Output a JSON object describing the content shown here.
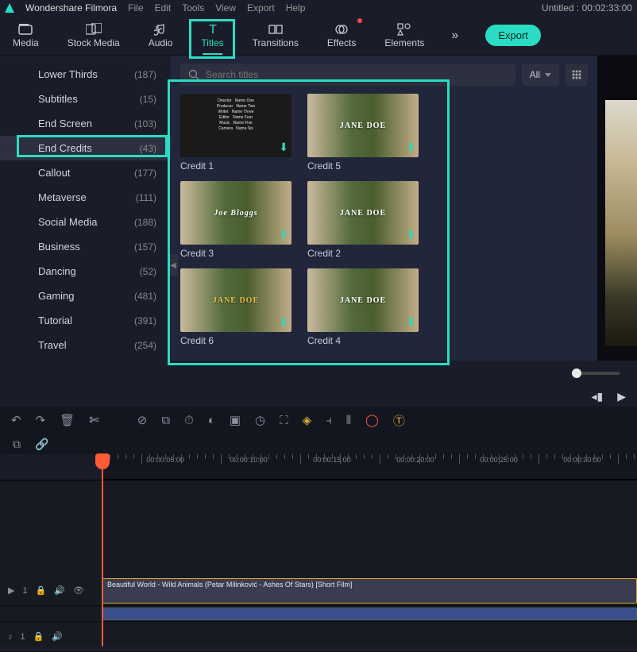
{
  "app": {
    "brand": "Wondershare Filmora",
    "project_title": "Untitled : 00:02:33:00"
  },
  "menu": {
    "file": "File",
    "edit": "Edit",
    "tools": "Tools",
    "view": "View",
    "export": "Export",
    "help": "Help"
  },
  "tabs": {
    "media": "Media",
    "stock": "Stock Media",
    "audio": "Audio",
    "titles": "Titles",
    "transitions": "Transitions",
    "effects": "Effects",
    "elements": "Elements"
  },
  "export_button": "Export",
  "sidebar": {
    "items": [
      {
        "label": "Lower Thirds",
        "count": "(187)"
      },
      {
        "label": "Subtitles",
        "count": "(15)"
      },
      {
        "label": "End Screen",
        "count": "(103)"
      },
      {
        "label": "End Credits",
        "count": "(43)"
      },
      {
        "label": "Callout",
        "count": "(177)"
      },
      {
        "label": "Metaverse",
        "count": "(111)"
      },
      {
        "label": "Social Media",
        "count": "(188)"
      },
      {
        "label": "Business",
        "count": "(157)"
      },
      {
        "label": "Dancing",
        "count": "(52)"
      },
      {
        "label": "Gaming",
        "count": "(481)"
      },
      {
        "label": "Tutorial",
        "count": "(391)"
      },
      {
        "label": "Travel",
        "count": "(254)"
      }
    ]
  },
  "search": {
    "placeholder": "Search titles",
    "filter": "All"
  },
  "gallery": [
    {
      "label": "Credit 1",
      "overlay": "credits"
    },
    {
      "label": "Credit 5",
      "overlay": "JANE DOE"
    },
    {
      "label": "Credit 3",
      "overlay": "Joe Bloggs"
    },
    {
      "label": "Credit 2",
      "overlay": "JANE DOE"
    },
    {
      "label": "Credit 6",
      "overlay": "JANE DOE"
    },
    {
      "label": "Credit 4",
      "overlay": "JANE DOE"
    }
  ],
  "ruler": {
    "marks": [
      "00:00:05:00",
      "00:00:10:00",
      "00:00:15:00",
      "00:00:20:00",
      "00:00:25:00",
      "00:00:30:00"
    ]
  },
  "tracks": {
    "video_label": "1",
    "audio_label": "1",
    "clip_title": "Beautiful World - Wild Animals (Petar Milinković - Ashes Of Stars) [Short Film]"
  }
}
